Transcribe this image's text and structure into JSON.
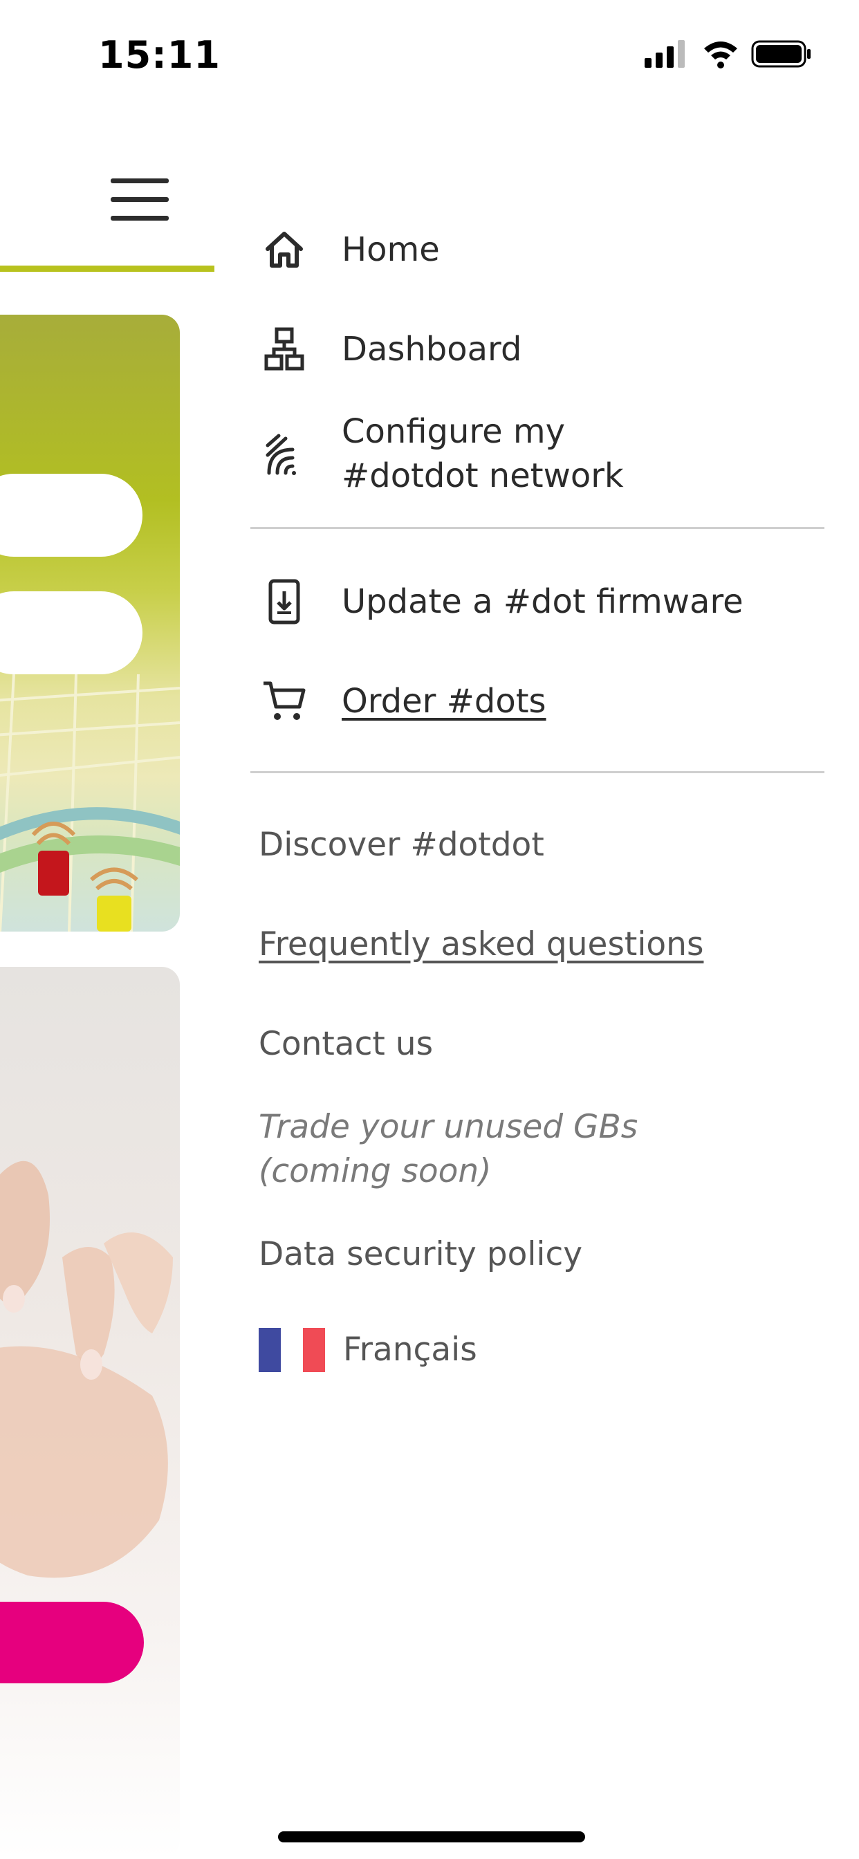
{
  "status_bar": {
    "time": "15:11",
    "icons": [
      "cellular-signal-icon",
      "wifi-icon",
      "battery-icon"
    ]
  },
  "colors": {
    "accent_line": "#b8c21e",
    "cta_pink": "#e6007e",
    "flag_blue": "#3f4aa0",
    "flag_white": "#ffffff",
    "flag_red": "#f04b55"
  },
  "drawer": {
    "primary_items": [
      {
        "icon": "home-icon",
        "label": "Home"
      },
      {
        "icon": "network-sitemap-icon",
        "label": "Dashboard"
      },
      {
        "icon": "signal-waves-icon",
        "label_line1": "Configure my",
        "label_line2": "#dotdot network"
      }
    ],
    "device_items": [
      {
        "icon": "phone-download-icon",
        "label": "Update a #dot firmware"
      },
      {
        "icon": "cart-icon",
        "label": "Order #dots"
      }
    ],
    "secondary_links": [
      {
        "label": "Discover #dotdot"
      },
      {
        "label": "Frequently asked questions"
      },
      {
        "label": "Contact us"
      },
      {
        "label_line1": "Trade your unused GBs",
        "label_line2": "(coming soon)"
      },
      {
        "label": "Data security policy"
      }
    ],
    "language": {
      "icon": "french-flag-icon",
      "label": "Français"
    }
  }
}
